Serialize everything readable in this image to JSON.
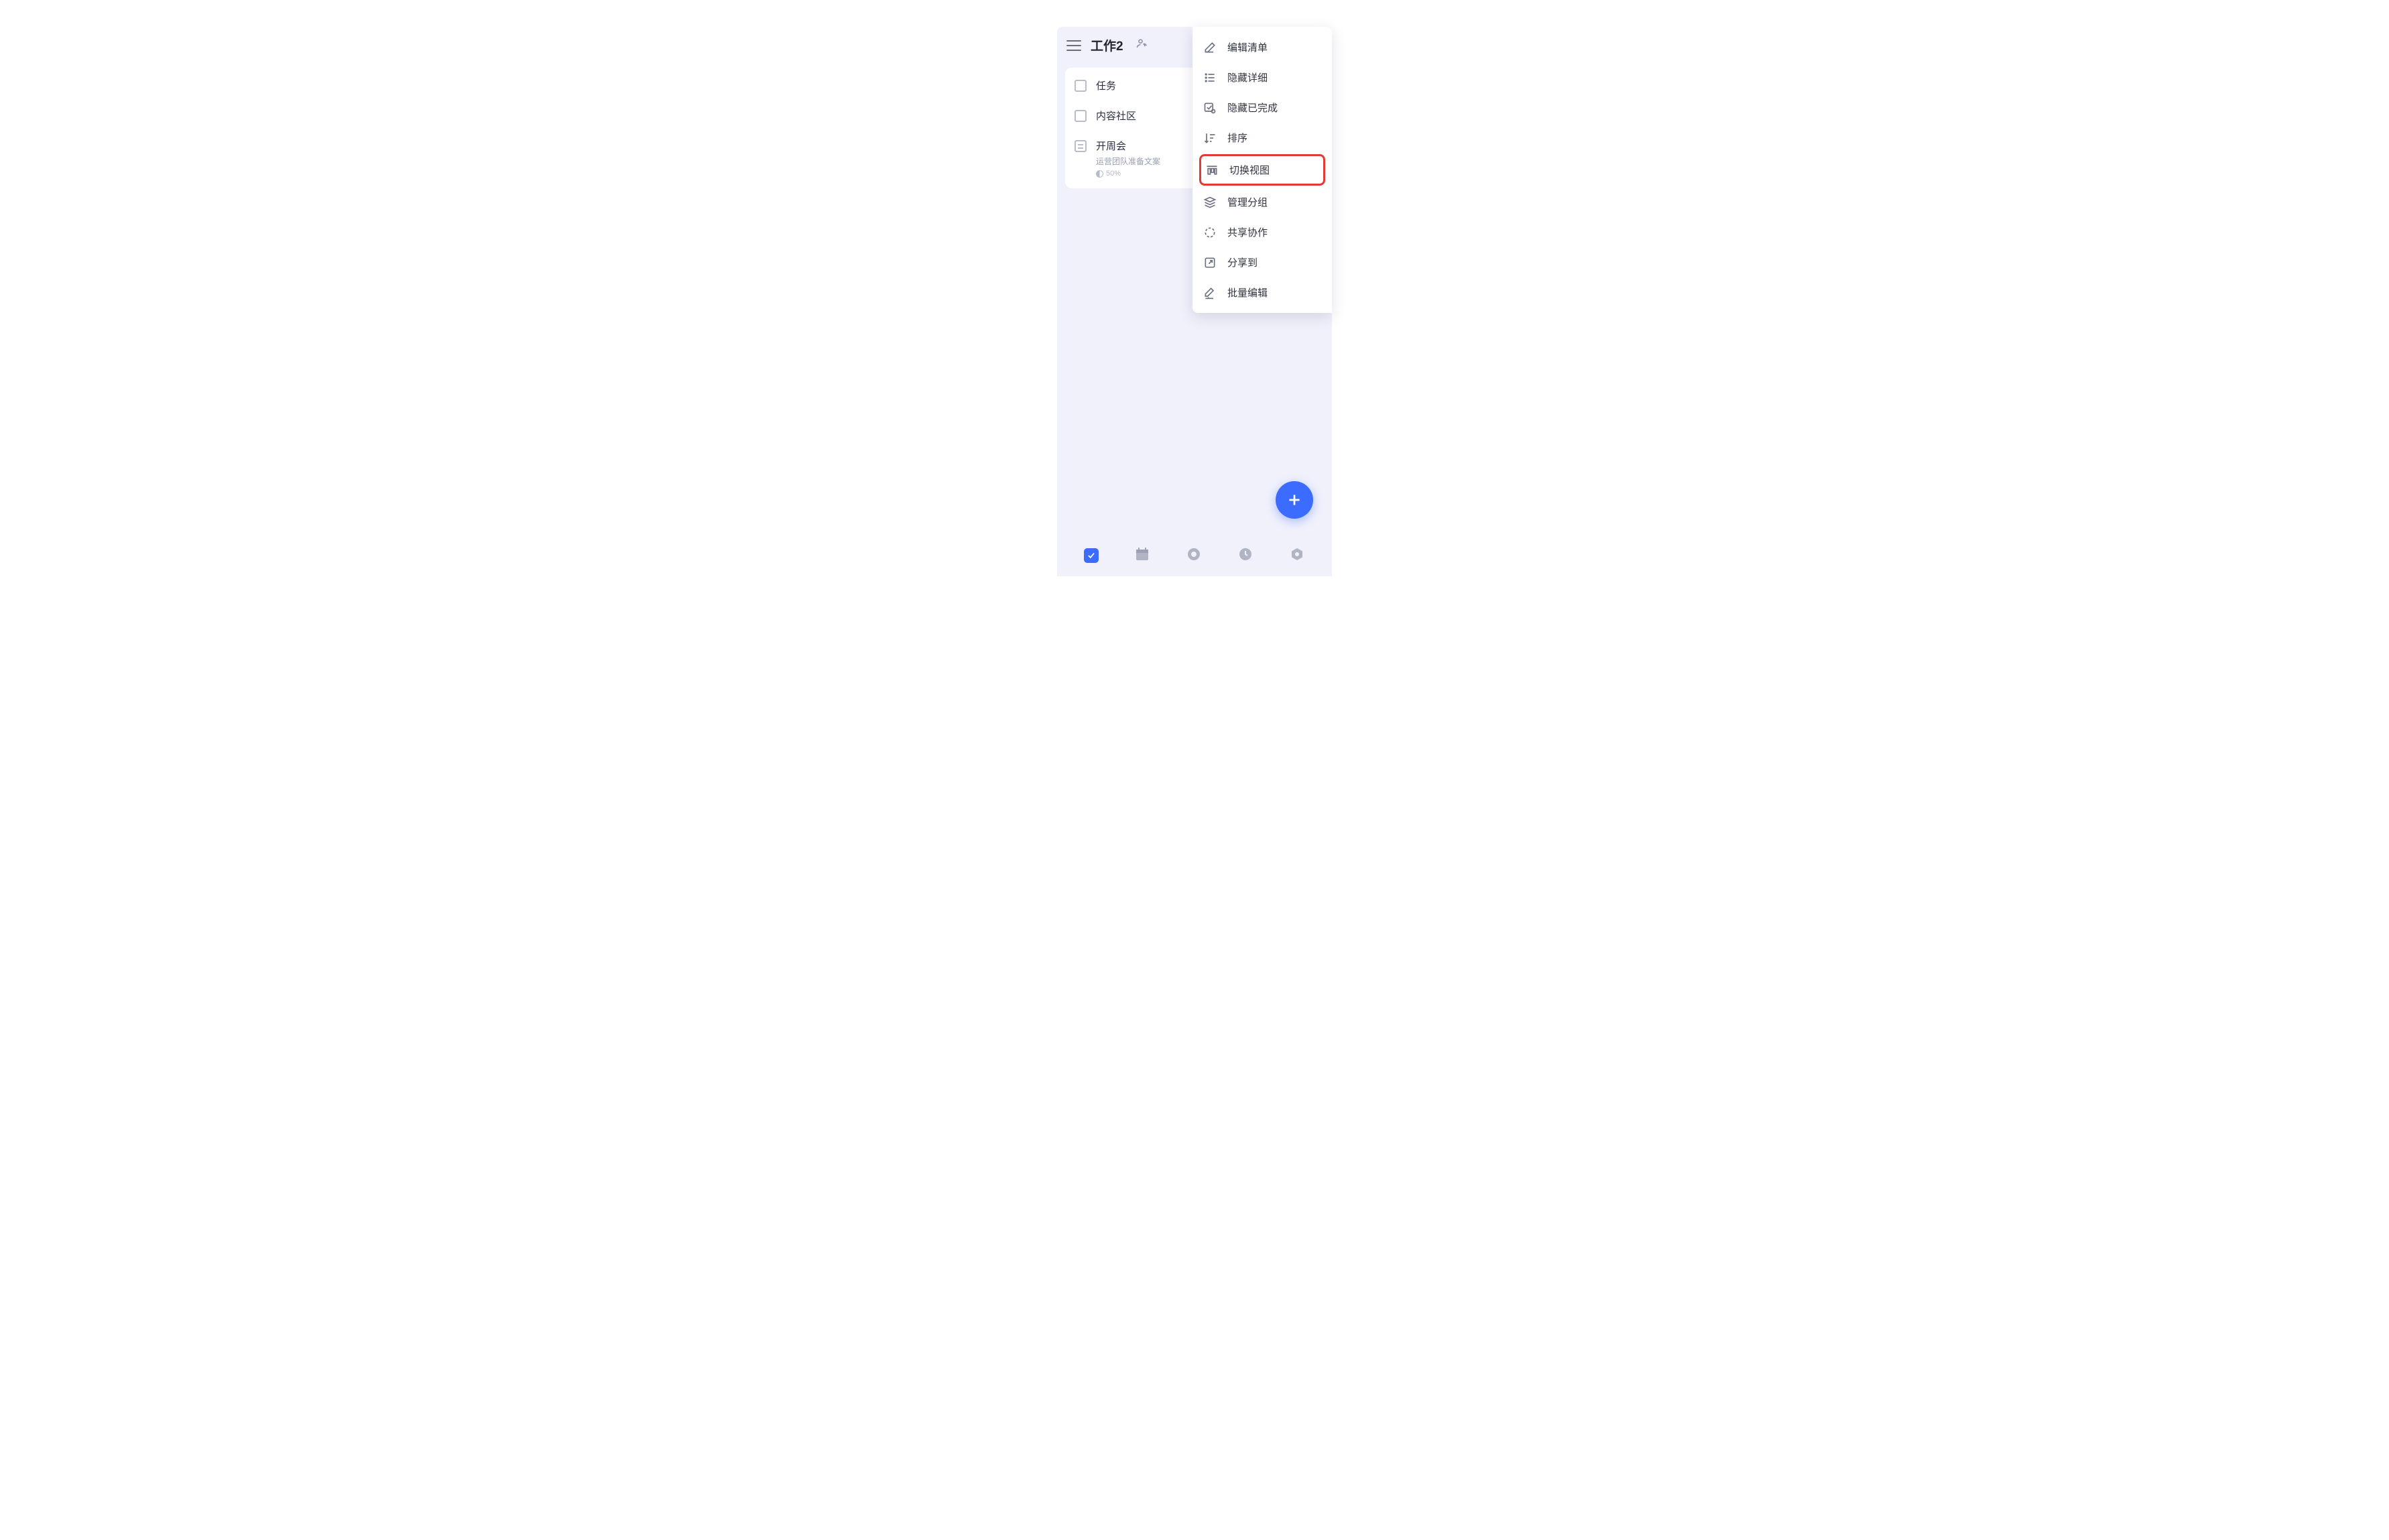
{
  "header": {
    "title": "工作2"
  },
  "list": {
    "items": [
      {
        "title": "任务",
        "type": "task"
      },
      {
        "title": "内容社区",
        "type": "task"
      },
      {
        "title": "开周会",
        "subtitle": "运营团队准备文案",
        "progress_label": "50%",
        "type": "note"
      }
    ]
  },
  "menu": {
    "items": [
      {
        "label": "编辑清单",
        "icon": "edit"
      },
      {
        "label": "隐藏详细",
        "icon": "list"
      },
      {
        "label": "隐藏已完成",
        "icon": "check-done"
      },
      {
        "label": "排序",
        "icon": "sort"
      },
      {
        "label": "切换视图",
        "icon": "columns",
        "highlight": true
      },
      {
        "label": "管理分组",
        "icon": "layers"
      },
      {
        "label": "共享协作",
        "icon": "circle-dashed"
      },
      {
        "label": "分享到",
        "icon": "share"
      },
      {
        "label": "批量编辑",
        "icon": "multi-edit"
      }
    ]
  }
}
